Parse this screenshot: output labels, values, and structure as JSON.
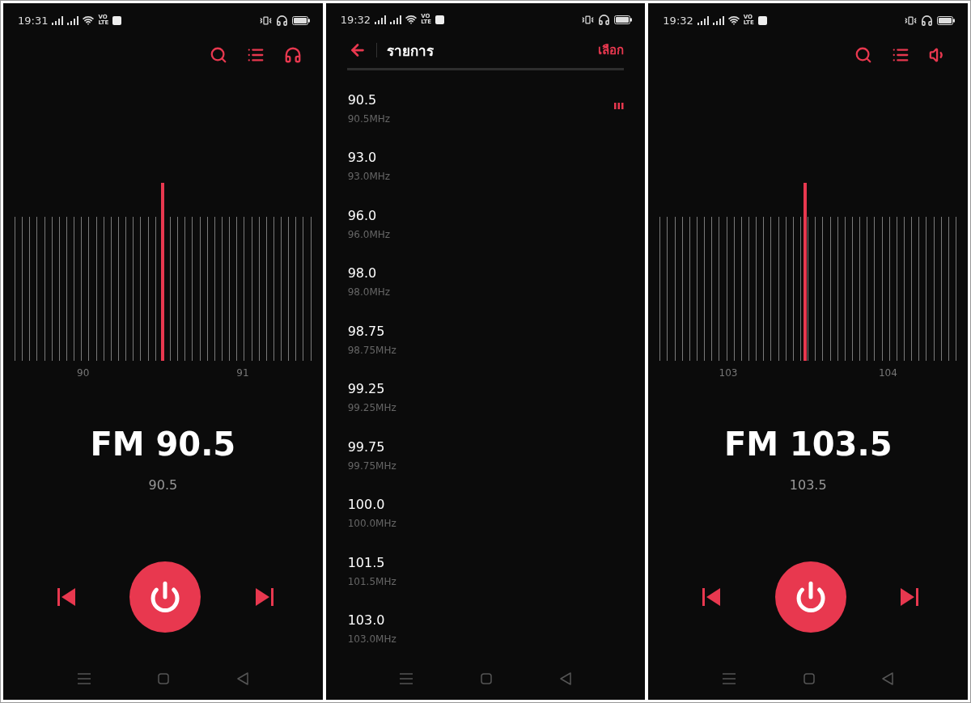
{
  "screens": [
    {
      "kind": "tuner",
      "status": {
        "time": "19:31",
        "volte_top": "VO",
        "volte_bottom": "LTE"
      },
      "toolbar": {
        "kind": "headphones"
      },
      "dial": {
        "level": 0.5,
        "labels": [
          "90",
          "91"
        ]
      },
      "title": "FM 90.5",
      "subtitle": "90.5",
      "power": {
        "on": true
      }
    },
    {
      "kind": "list",
      "status": {
        "time": "19:32",
        "volte_top": "VO",
        "volte_bottom": "LTE"
      },
      "header": {
        "title": "รายการ",
        "action": "เลือก"
      },
      "stations": [
        {
          "name": "90.5",
          "freq": "90.5MHz",
          "playing": true
        },
        {
          "name": "93.0",
          "freq": "93.0MHz",
          "playing": false
        },
        {
          "name": "96.0",
          "freq": "96.0MHz",
          "playing": false
        },
        {
          "name": "98.0",
          "freq": "98.0MHz",
          "playing": false
        },
        {
          "name": "98.75",
          "freq": "98.75MHz",
          "playing": false
        },
        {
          "name": "99.25",
          "freq": "99.25MHz",
          "playing": false
        },
        {
          "name": "99.75",
          "freq": "99.75MHz",
          "playing": false
        },
        {
          "name": "100.0",
          "freq": "100.0MHz",
          "playing": false
        },
        {
          "name": "101.5",
          "freq": "101.5MHz",
          "playing": false
        },
        {
          "name": "103.0",
          "freq": "103.0MHz",
          "playing": false
        }
      ]
    },
    {
      "kind": "tuner",
      "status": {
        "time": "19:32",
        "volte_top": "VO",
        "volte_bottom": "LTE"
      },
      "toolbar": {
        "kind": "speaker"
      },
      "dial": {
        "level": 0.49,
        "labels": [
          "103",
          "104"
        ]
      },
      "title": "FM 103.5",
      "subtitle": "103.5",
      "power": {
        "on": true
      }
    }
  ]
}
